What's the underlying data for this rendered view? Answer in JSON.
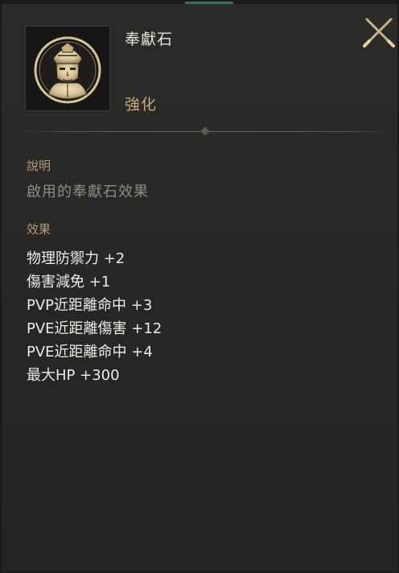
{
  "item": {
    "name": "奉獻石",
    "category": "強化",
    "icon": "masked-figure-emblem-icon"
  },
  "close_icon": "close-x-icon",
  "description": {
    "label": "說明",
    "text": "啟用的奉獻石效果"
  },
  "effects": {
    "label": "效果",
    "items": [
      "物理防禦力 +2",
      "傷害減免 +1",
      "PVP近距離命中 +3",
      "PVE近距離傷害 +12",
      "PVE近距離命中 +4",
      "最大HP +300"
    ]
  },
  "colors": {
    "background": "#272726",
    "name_text": "#e4e0d6",
    "category_text": "#c9aa7c",
    "label_text": "#b39a7e",
    "description_text": "#8f8c84",
    "effect_text": "#ecebe6"
  }
}
